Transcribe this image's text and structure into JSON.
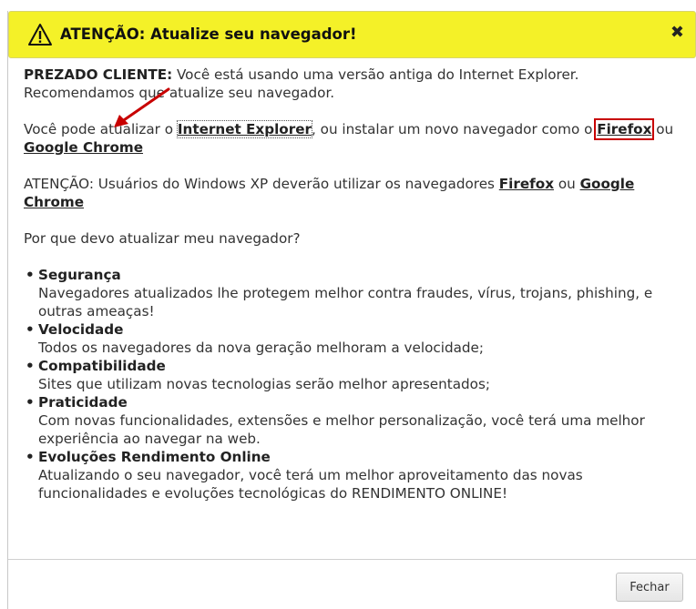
{
  "dialog": {
    "title": "ATENÇÃO: Atualize seu navegador!",
    "close_glyph": "✖",
    "icons": {
      "warning": "warning-triangle-icon",
      "close": "close-icon",
      "arrow": "red-arrow-annotation"
    },
    "colors": {
      "titlebar_bg": "#f4f128",
      "highlight_box": "#c80000",
      "arrow": "#c80000"
    }
  },
  "intro": {
    "greeting": "PREZADO CLIENTE:",
    "text": " Você está usando uma versão antiga do Internet Explorer. Recomendamos que atualize seu navegador."
  },
  "update": {
    "prefix": "Você pode atualizar o ",
    "ie_link": "Internet Explorer",
    "middle": ", ou instalar um novo navegador como o ",
    "firefox_link": "Firefox",
    "or": " ou ",
    "chrome_link": "Google Chrome"
  },
  "xp_notice": {
    "text": "ATENÇÃO: Usuários do Windows XP deverão utilizar os navegadores ",
    "firefox_link": "Firefox",
    "or": " ou ",
    "chrome_link": "Google Chrome"
  },
  "question": "Por que devo atualizar meu navegador?",
  "reasons": [
    {
      "title": "Segurança",
      "desc": "Navegadores atualizados lhe protegem melhor contra fraudes, vírus, trojans, phishing, e outras ameaças!"
    },
    {
      "title": "Velocidade",
      "desc": "Todos os navegadores da nova geração melhoram a velocidade;"
    },
    {
      "title": "Compatibilidade",
      "desc": "Sites que utilizam novas tecnologias serão melhor apresentados;"
    },
    {
      "title": "Praticidade",
      "desc": "Com novas funcionalidades, extensões e melhor personalização, você terá uma melhor experiência ao navegar na web."
    },
    {
      "title": "Evoluções Rendimento Online",
      "desc": "Atualizando o seu navegador, você terá um melhor aproveitamento das novas funcionalidades e evoluções tecnológicas do RENDIMENTO ONLINE!"
    }
  ],
  "footer": {
    "close_button": "Fechar"
  }
}
